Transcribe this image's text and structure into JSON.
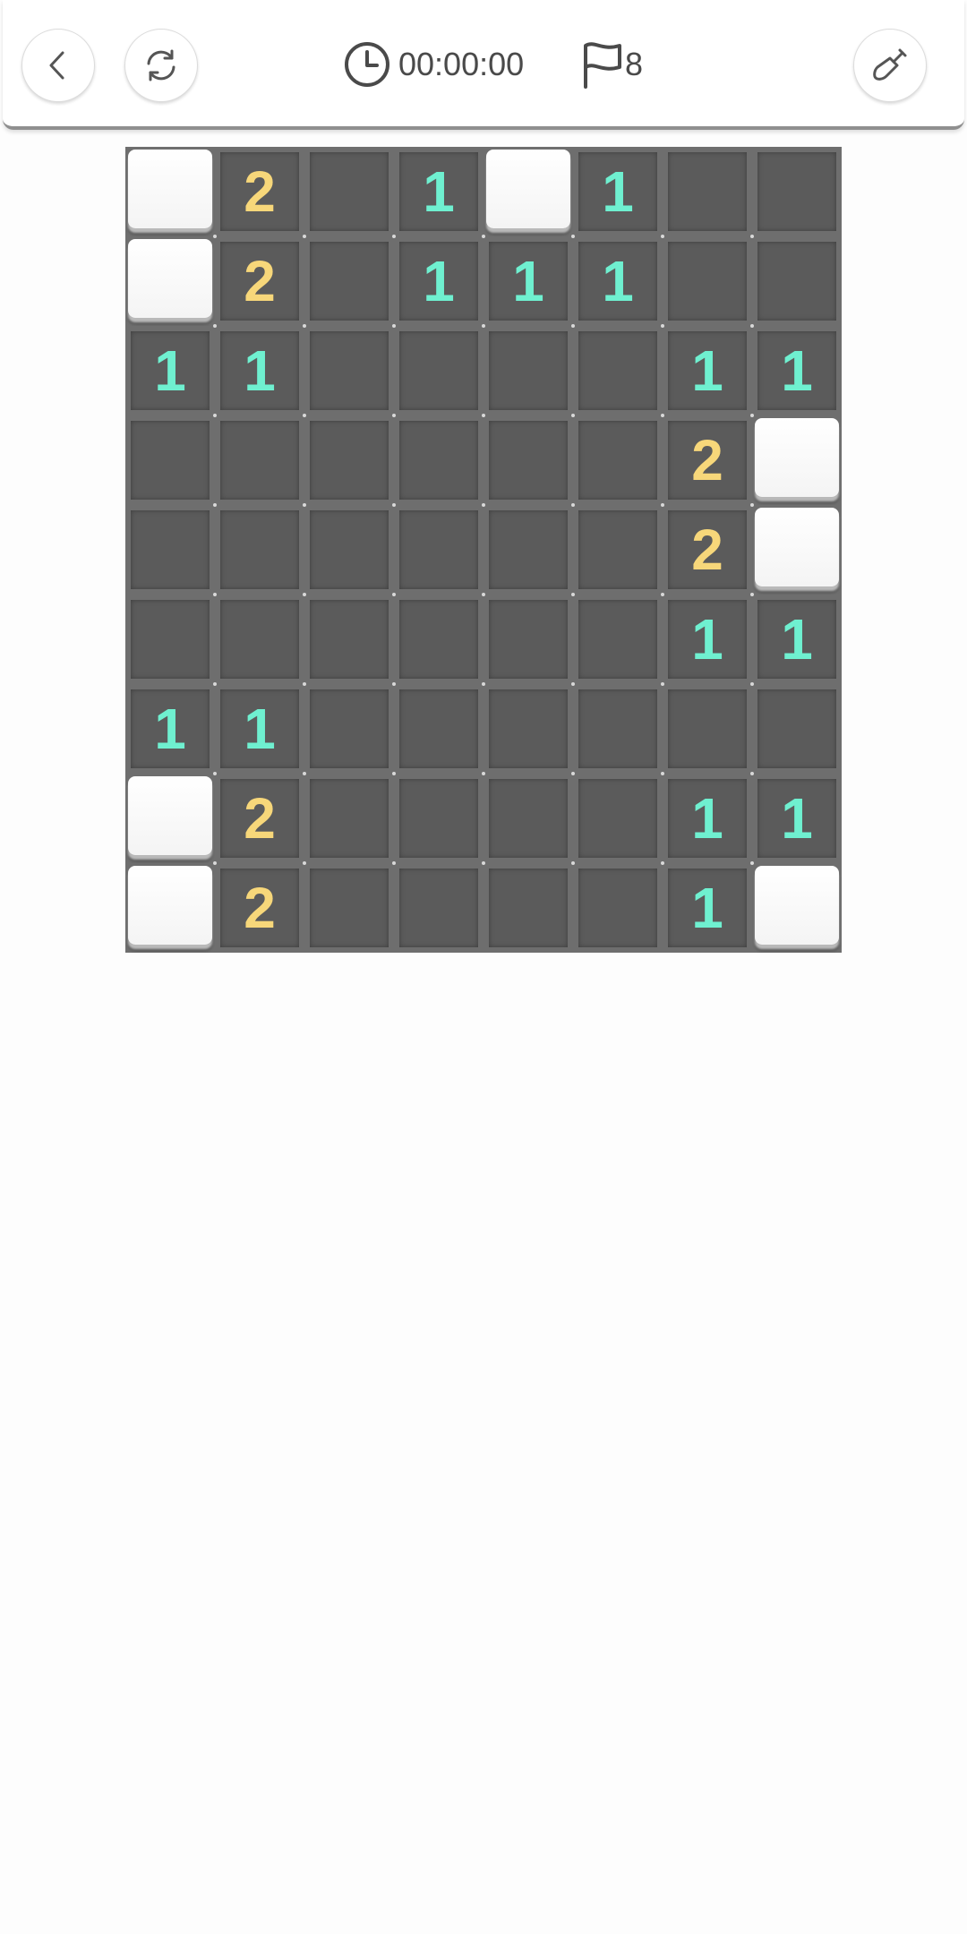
{
  "header": {
    "timer": "00:00:00",
    "flag_count": "8",
    "icons": {
      "back": "chevron-left-icon",
      "restart": "refresh-icon",
      "timer": "clock-icon",
      "flag": "flag-icon",
      "shovel": "shovel-icon"
    }
  },
  "colors": {
    "number_1": "#6ff0d0",
    "number_2": "#f7d77a",
    "revealed_cell": "#5b5b5b",
    "hidden_tile": "#ffffff"
  },
  "board": {
    "columns": 8,
    "rows": 9,
    "cells": [
      [
        "H",
        "2",
        "",
        "1",
        "H",
        "1",
        "",
        ""
      ],
      [
        "H",
        "2",
        "",
        "1",
        "1",
        "1",
        "",
        ""
      ],
      [
        "1",
        "1",
        "",
        "",
        "",
        "",
        "1",
        "1"
      ],
      [
        "",
        "",
        "",
        "",
        "",
        "",
        "2",
        "H"
      ],
      [
        "",
        "",
        "",
        "",
        "",
        "",
        "2",
        "H"
      ],
      [
        "",
        "",
        "",
        "",
        "",
        "",
        "1",
        "1"
      ],
      [
        "1",
        "1",
        "",
        "",
        "",
        "",
        "",
        ""
      ],
      [
        "H",
        "2",
        "",
        "",
        "",
        "",
        "1",
        "1"
      ],
      [
        "H",
        "2",
        "",
        "",
        "",
        "",
        "1",
        "H"
      ]
    ]
  }
}
